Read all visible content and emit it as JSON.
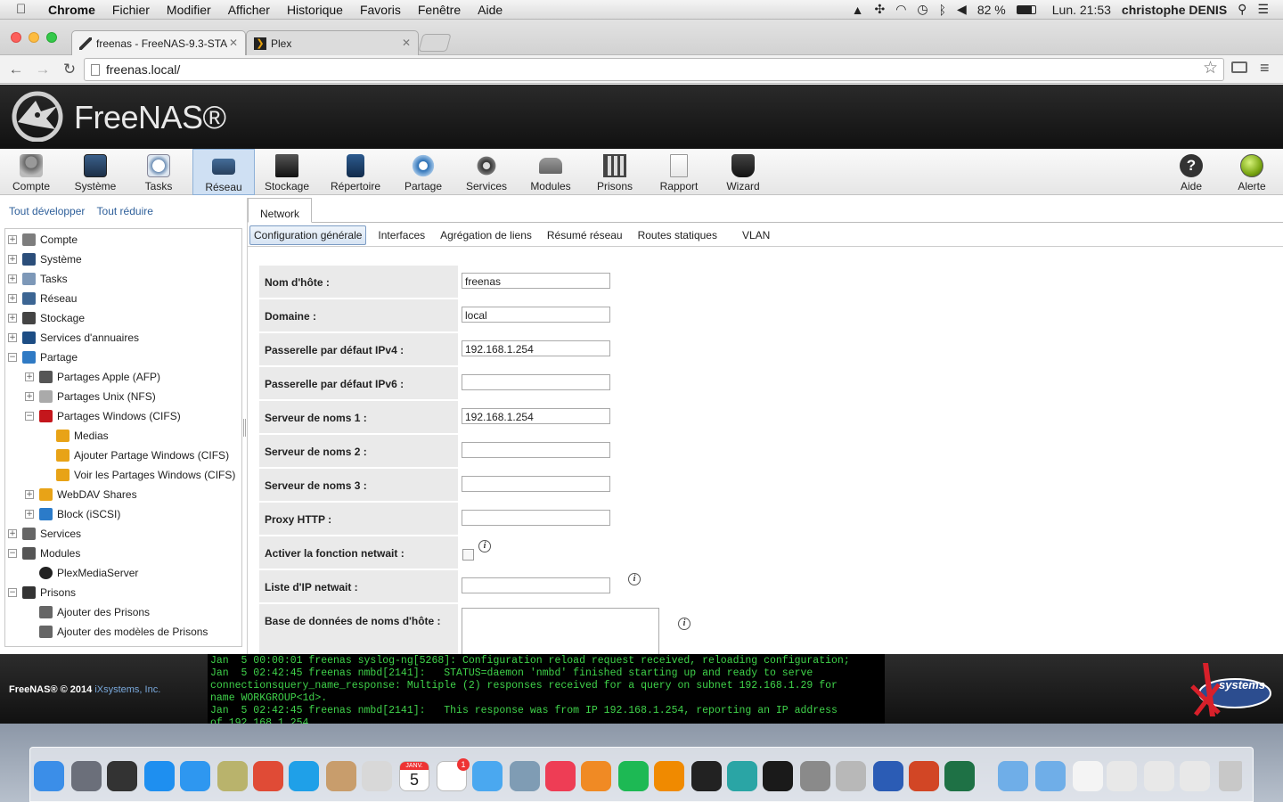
{
  "menubar": {
    "app": "Chrome",
    "items": [
      "Fichier",
      "Modifier",
      "Afficher",
      "Historique",
      "Favoris",
      "Fenêtre",
      "Aide"
    ],
    "battery": "82 %",
    "clock": "Lun. 21:53",
    "user": "christophe DENIS"
  },
  "browser": {
    "tabs": [
      {
        "title": "freenas - FreeNAS-9.3-STA"
      },
      {
        "title": "Plex"
      }
    ],
    "url": "freenas.local/"
  },
  "freenas": {
    "logo_text": "FreeNAS®",
    "nav": [
      {
        "label": "Compte",
        "icon": "users-icon"
      },
      {
        "label": "Système",
        "icon": "system-icon"
      },
      {
        "label": "Tasks",
        "icon": "tasks-icon"
      },
      {
        "label": "Réseau",
        "icon": "network-icon"
      },
      {
        "label": "Stockage",
        "icon": "storage-icon"
      },
      {
        "label": "Répertoire",
        "icon": "directory-icon"
      },
      {
        "label": "Partage",
        "icon": "sharing-icon"
      },
      {
        "label": "Services",
        "icon": "services-icon"
      },
      {
        "label": "Modules",
        "icon": "plugins-icon"
      },
      {
        "label": "Prisons",
        "icon": "jails-icon"
      },
      {
        "label": "Rapport",
        "icon": "reporting-icon"
      },
      {
        "label": "Wizard",
        "icon": "wizard-icon"
      },
      {
        "label": "Aide",
        "icon": "help-icon"
      },
      {
        "label": "Alerte",
        "icon": "alert-icon"
      }
    ],
    "active_nav": "Réseau",
    "left": {
      "expand_all": "Tout développer",
      "collapse_all": "Tout réduire",
      "tree": [
        {
          "label": "Compte",
          "level": 0,
          "exp": "+"
        },
        {
          "label": "Système",
          "level": 0,
          "exp": "+"
        },
        {
          "label": "Tasks",
          "level": 0,
          "exp": "+"
        },
        {
          "label": "Réseau",
          "level": 0,
          "exp": "+"
        },
        {
          "label": "Stockage",
          "level": 0,
          "exp": "+"
        },
        {
          "label": "Services d'annuaires",
          "level": 0,
          "exp": "+"
        },
        {
          "label": "Partage",
          "level": 0,
          "exp": "−"
        },
        {
          "label": "Partages Apple (AFP)",
          "level": 1,
          "exp": "+"
        },
        {
          "label": "Partages Unix (NFS)",
          "level": 1,
          "exp": "+"
        },
        {
          "label": "Partages Windows (CIFS)",
          "level": 1,
          "exp": "−"
        },
        {
          "label": "Medias",
          "level": 2,
          "exp": ""
        },
        {
          "label": "Ajouter Partage Windows (CIFS)",
          "level": 2,
          "exp": ""
        },
        {
          "label": "Voir les Partages Windows (CIFS)",
          "level": 2,
          "exp": ""
        },
        {
          "label": "WebDAV Shares",
          "level": 1,
          "exp": "+"
        },
        {
          "label": "Block (iSCSI)",
          "level": 1,
          "exp": "+"
        },
        {
          "label": "Services",
          "level": 0,
          "exp": "+"
        },
        {
          "label": "Modules",
          "level": 0,
          "exp": "−"
        },
        {
          "label": "PlexMediaServer",
          "level": 1,
          "exp": ""
        },
        {
          "label": "Prisons",
          "level": 0,
          "exp": "−"
        },
        {
          "label": "Ajouter des Prisons",
          "level": 1,
          "exp": ""
        },
        {
          "label": "Ajouter des modèles de Prisons",
          "level": 1,
          "exp": ""
        }
      ]
    },
    "main": {
      "outer_tab": "Network",
      "subtabs": [
        "Configuration générale",
        "Interfaces",
        "Agrégation de liens",
        "Résumé réseau",
        "Routes statiques",
        "VLAN"
      ],
      "active_subtab": "Configuration générale",
      "fields": [
        {
          "label": "Nom d'hôte :",
          "value": "freenas",
          "type": "text"
        },
        {
          "label": "Domaine :",
          "value": "local",
          "type": "text"
        },
        {
          "label": "Passerelle par défaut IPv4 :",
          "value": "192.168.1.254",
          "type": "text"
        },
        {
          "label": "Passerelle par défaut IPv6 :",
          "value": "",
          "type": "text"
        },
        {
          "label": "Serveur de noms 1 :",
          "value": "192.168.1.254",
          "type": "text"
        },
        {
          "label": "Serveur de noms 2 :",
          "value": "",
          "type": "text"
        },
        {
          "label": "Serveur de noms 3 :",
          "value": "",
          "type": "text"
        },
        {
          "label": "Proxy HTTP :",
          "value": "",
          "type": "text"
        },
        {
          "label": "Activer la fonction netwait :",
          "value": "",
          "type": "checkbox"
        },
        {
          "label": "Liste d'IP netwait :",
          "value": "",
          "type": "text"
        },
        {
          "label": "Base de données de noms d'hôte :",
          "value": "",
          "type": "textarea"
        }
      ]
    },
    "footer": {
      "copyright": "FreeNAS® © 2014 ",
      "company": "iXsystems, Inc.",
      "console": [
        "Jan  5 00:00:01 freenas syslog-ng[5268]: Configuration reload request received, reloading configuration;",
        "Jan  5 02:42:45 freenas nmbd[2141]:   STATUS=daemon 'nmbd' finished starting up and ready to serve",
        "connectionsquery_name_response: Multiple (2) responses received for a query on subnet 192.168.1.29 for",
        "name WORKGROUP<1d>.",
        "Jan  5 02:42:45 freenas nmbd[2141]:   This response was from IP 192.168.1.254, reporting an IP address",
        "of 192.168.1.254."
      ],
      "ix_logo_text": "systems"
    }
  },
  "dock": {
    "calendar_month": "JANV.",
    "calendar_day": "5",
    "reminders_badge": "1",
    "apps": [
      "finder-icon",
      "launchpad-icon",
      "dashboard-icon",
      "app-store-icon",
      "safari-icon",
      "preview-icon",
      "chrome-icon",
      "skype-icon",
      "contacts-icon",
      "photos-icon",
      "calendar-icon",
      "reminders-icon",
      "messages-icon",
      "image-capture-icon",
      "itunes-icon",
      "ibooks-icon",
      "spotify-icon",
      "vlc-icon",
      "plex-icon",
      "photo-booth-icon",
      "time-machine-icon",
      "system-preferences-icon",
      "scrivener-icon",
      "word-icon",
      "powerpoint-icon",
      "excel-icon",
      "applications-folder-icon",
      "documents-folder-icon",
      "document-icon",
      "screenshot-1-icon",
      "screenshot-2-icon",
      "screenshot-3-icon",
      "trash-icon"
    ]
  },
  "colors": {
    "console_green": "#3fd24a",
    "link_blue": "#2e5f9a",
    "active_nav_bg": "#cfe0f3",
    "label_bg": "#eaeaea"
  }
}
